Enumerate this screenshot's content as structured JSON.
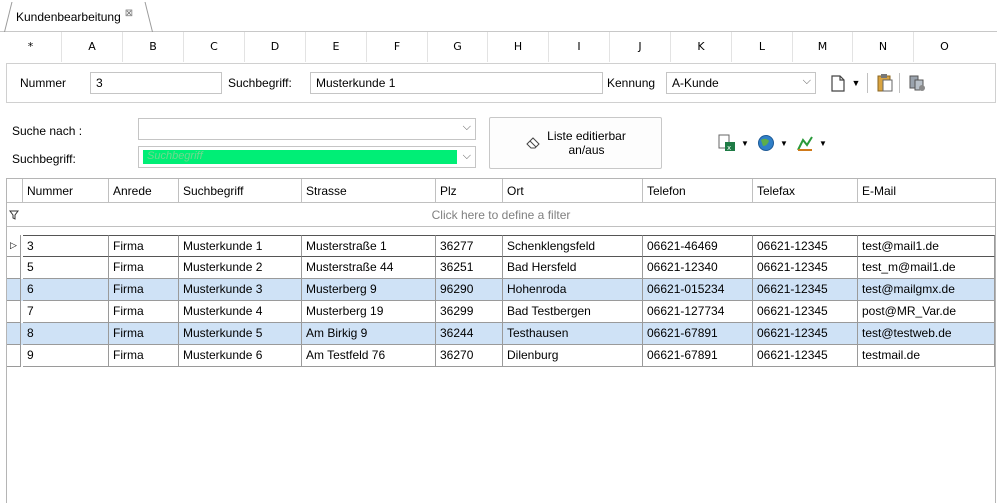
{
  "window": {
    "tab_title": "Kundenbearbeitung"
  },
  "ruler": [
    "*",
    "A",
    "B",
    "C",
    "D",
    "E",
    "F",
    "G",
    "H",
    "I",
    "J",
    "K",
    "L",
    "M",
    "N",
    "O"
  ],
  "form": {
    "nummer_label": "Nummer",
    "nummer_value": "3",
    "suchbegriff_label": "Suchbegriff:",
    "suchbegriff_value": "Musterkunde 1",
    "kennung_label": "Kennung",
    "kennung_value": "A-Kunde"
  },
  "search": {
    "suche_nach_label": "Suche nach :",
    "suche_nach_value": "",
    "suchbegriff_label": "Suchbegriff:",
    "suchbegriff_placeholder": "Suchbegriff",
    "toggle_button_line1": "Liste editierbar",
    "toggle_button_line2": "an/aus"
  },
  "grid": {
    "columns": [
      "Nummer",
      "Anrede",
      "Suchbegriff",
      "Strasse",
      "Plz",
      "Ort",
      "Telefon",
      "Telefax",
      "E-Mail"
    ],
    "filter_hint": "Click here to define a filter",
    "rows": [
      [
        "3",
        "Firma",
        "Musterkunde 1",
        "Musterstraße 1",
        "36277",
        "Schenklengsfeld",
        "06621-46469",
        "06621-12345",
        "test@mail1.de"
      ],
      [
        "5",
        "Firma",
        "Musterkunde 2",
        "Musterstraße 44",
        "36251",
        "Bad Hersfeld",
        "06621-12340",
        "06621-12345",
        "test_m@mail1.de"
      ],
      [
        "6",
        "Firma",
        "Musterkunde 3",
        "Musterberg 9",
        "96290",
        "Hohenroda",
        "06621-015234",
        "06621-12345",
        "test@mailgmx.de"
      ],
      [
        "7",
        "Firma",
        "Musterkunde 4",
        "Musterberg 19",
        "36299",
        "Bad Testbergen",
        "06621-127734",
        "06621-12345",
        "post@MR_Var.de"
      ],
      [
        "8",
        "Firma",
        "Musterkunde 5",
        "Am Birkig 9",
        "36244",
        "Testhausen",
        "06621-67891",
        "06621-12345",
        "test@testweb.de"
      ],
      [
        "9",
        "Firma",
        "Musterkunde 6",
        "Am Testfeld 76",
        "36270",
        "Dilenburg",
        "06621-67891",
        "06621-12345",
        "testmail.de"
      ]
    ],
    "selected_row": 0
  },
  "colors": {
    "alt_row": "#cfe2f6",
    "search_field_fill": "#00ee76",
    "border": "#c5c5c5"
  }
}
